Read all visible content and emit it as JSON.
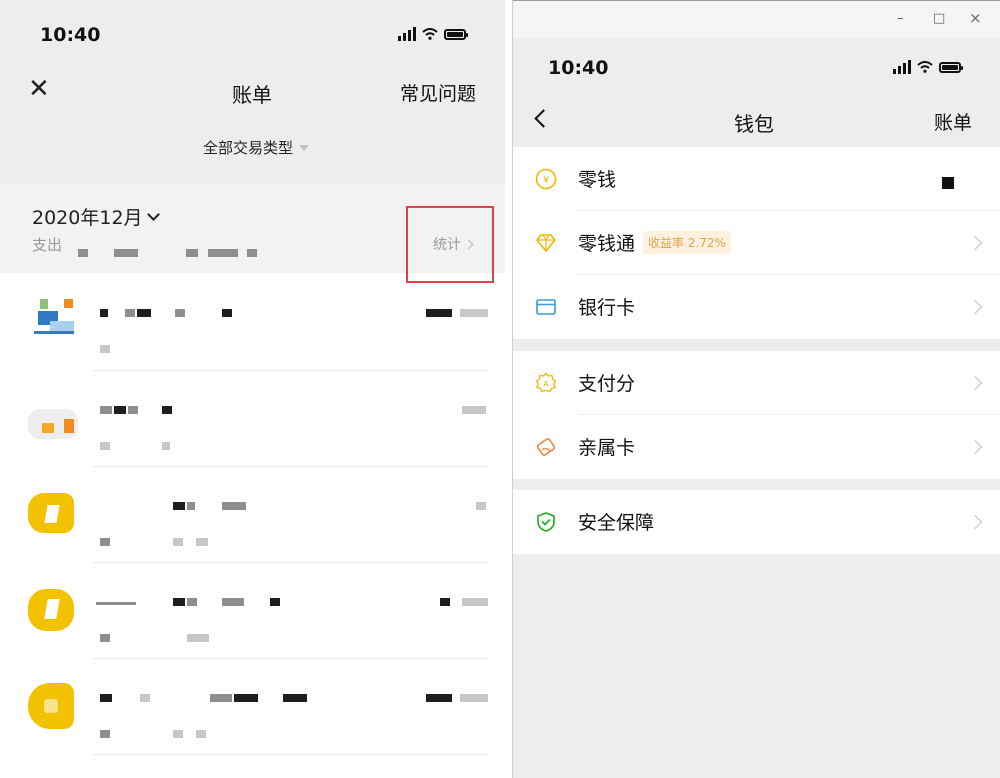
{
  "left": {
    "status": {
      "time": "10:40"
    },
    "nav": {
      "title": "账单",
      "right_action": "常见问题"
    },
    "filter": {
      "label": "全部交易类型"
    },
    "summary": {
      "month": "2020年12月",
      "expense_label": "支出",
      "stats_label": "统计"
    }
  },
  "right": {
    "status": {
      "time": "10:40"
    },
    "window_controls": {
      "minimize": "–",
      "maximize": "□",
      "close": "×"
    },
    "nav": {
      "title": "钱包",
      "right_action": "账单"
    },
    "groups": [
      [
        {
          "label": "零钱",
          "icon": "yuan-coin-icon",
          "color": "#f5b400"
        },
        {
          "label": "零钱通",
          "icon": "diamond-icon",
          "color": "#f5b400",
          "badge": "收益率 2.72%"
        },
        {
          "label": "银行卡",
          "icon": "bank-card-icon",
          "color": "#3a9bdc"
        }
      ],
      [
        {
          "label": "支付分",
          "icon": "pay-score-icon",
          "color": "#f5b400"
        },
        {
          "label": "亲属卡",
          "icon": "family-card-icon",
          "color": "#e58a4a"
        }
      ],
      [
        {
          "label": "安全保障",
          "icon": "shield-icon",
          "color": "#1aad19"
        }
      ]
    ]
  }
}
